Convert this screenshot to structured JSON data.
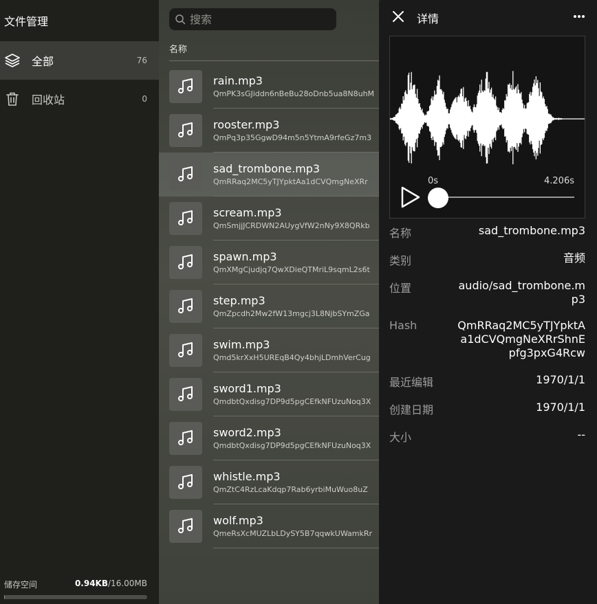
{
  "sidebar": {
    "title": "文件管理",
    "items": [
      {
        "label": "全部",
        "count": "76"
      },
      {
        "label": "回收站",
        "count": "0"
      }
    ],
    "storage": {
      "label": "储存空间",
      "used": "0.94KB",
      "total": "/16.00MB",
      "used_fraction": 0.0001
    }
  },
  "list": {
    "search_placeholder": "搜索",
    "column_header": "名称",
    "rows": [
      {
        "name": "rain.mp3",
        "hash": "QmPK3sGJiddn6nBeBu28oDnb5ua8N8uhM"
      },
      {
        "name": "rooster.mp3",
        "hash": "QmPq3p35GgwD94m5n5YtmA9rfeGz7m3"
      },
      {
        "name": "sad_trombone.mp3",
        "hash": "QmRRaq2MC5yTJYpktAa1dCVQmgNeXRr"
      },
      {
        "name": "scream.mp3",
        "hash": "QmSmjjJCRDWN2AUygVfW2nNy9X8QRkb"
      },
      {
        "name": "spawn.mp3",
        "hash": "QmXMgCjudjq7QwXDieQTMriL9sqmL2s6t"
      },
      {
        "name": "step.mp3",
        "hash": "QmZpcdh2Mw2fW13mgcj3L8NjbSYmZGa"
      },
      {
        "name": "swim.mp3",
        "hash": "Qmd5krXxH5UREqB4Qy4bhjLDmhVerCug"
      },
      {
        "name": "sword1.mp3",
        "hash": "QmdbtQxdisg7DP9d5pgCEfkNFUzuNoq3X"
      },
      {
        "name": "sword2.mp3",
        "hash": "QmdbtQxdisg7DP9d5pgCEfkNFUzuNoq3X"
      },
      {
        "name": "whistle.mp3",
        "hash": "QmZtC4RzLcaKdqp7Rab6yrbiMuWuo8uZ"
      },
      {
        "name": "wolf.mp3",
        "hash": "QmeRsXcMUZLbLDySY5B7qqwkUWamkRr"
      }
    ]
  },
  "detail": {
    "title": "详情",
    "player": {
      "time_start": "0s",
      "time_end": "4.206s",
      "progress": 0
    },
    "fields": [
      {
        "key": "名称",
        "value": "sad_trombone.mp3"
      },
      {
        "key": "类别",
        "value": "音频"
      },
      {
        "key": "位置",
        "value": "audio/sad_trombone.mp3"
      },
      {
        "key": "Hash",
        "value": "QmRRaq2MC5yTJYpktAa1dCVQmgNeXRrShnEpfg3pxG4Rcw"
      },
      {
        "key": "最近编辑",
        "value": "1970/1/1"
      },
      {
        "key": "创建日期",
        "value": "1970/1/1"
      },
      {
        "key": "大小",
        "value": "--"
      }
    ]
  }
}
